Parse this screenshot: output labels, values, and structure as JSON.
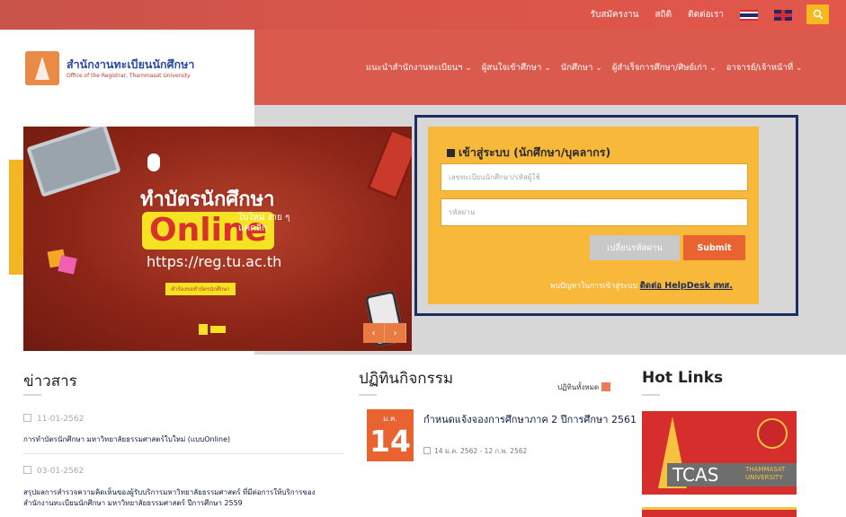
{
  "topbar": {
    "links": [
      "รับสมัครงาน",
      "สถิติ",
      "ติดต่อเรา"
    ],
    "colors": {
      "bar": "#d8554a",
      "search_button": "#f7b91d"
    }
  },
  "logo": {
    "title": "สำนักงานทะเบียนนักศึกษา",
    "subtitle": "Office of the Registrar, Thammasat University"
  },
  "nav": {
    "items": [
      "แนะนำสำนักงานทะเบียนฯ",
      "ผู้สนใจเข้าศึกษา",
      "นักศึกษา",
      "ผู้สำเร็จการศึกษา/ศิษย์เก่า",
      "อาจารย์/เจ้าหน้าที่"
    ]
  },
  "banner": {
    "headline": "ทำบัตรนักศึกษา",
    "online": "Online",
    "tagline": "ใบใหม่ ง่าย ๆ แค่คลิก",
    "url": "https://reg.tu.ac.th",
    "tag": "คำร้องขอทำบัตรนักศึกษา",
    "prev": "‹",
    "next": "›"
  },
  "login": {
    "title": "เข้าสู่ระบบ (นักศึกษา/บุคลากร)",
    "username_placeholder": "เลขทะเบียนนักศึกษา/รหัสผู้ใช้",
    "password_placeholder": "รหัสผ่าน",
    "change_password_label": "เปลี่ยนรหัสผ่าน",
    "submit_label": "Submit",
    "help_text": "พบปัญหาในการเข้าสู่ระบบ",
    "help_link": "ติดต่อ HelpDesk สทส."
  },
  "news": {
    "title": "ข่าวสาร",
    "items": [
      {
        "date": "11-01-2562",
        "text": "การทำบัตรนักศึกษา มหาวิทยาลัยธรรมศาสตร์ใบใหม่ (แบบOnline)"
      },
      {
        "date": "03-01-2562",
        "text": "สรุปผลการสำรวจความคิดเห็นของผู้รับบริการมหาวิทยาลัยธรรมศาสตร์ ที่มีต่อการให้บริการของสำนักงานทะเบียนนักศึกษา มหาวิทยาลัยธรรมศาสตร์ ปีการศึกษา 2559"
      }
    ]
  },
  "activities": {
    "title": "ปฏิทินกิจกรรม",
    "all_label": "ปฏิทินทั้งหมด",
    "event": {
      "month": "ม.ค.",
      "day": "14",
      "title": "กำหนดแจ้งจองการศึกษาภาค 2 ปีการศึกษา 2561",
      "range": "14 ม.ค. 2562 - 12 ก.พ. 2562"
    }
  },
  "hotlinks": {
    "title": "Hot Links",
    "banner_text": "TCAS",
    "banner_sub1": "THAMMASAT",
    "banner_sub2": "UNIVERSITY"
  }
}
